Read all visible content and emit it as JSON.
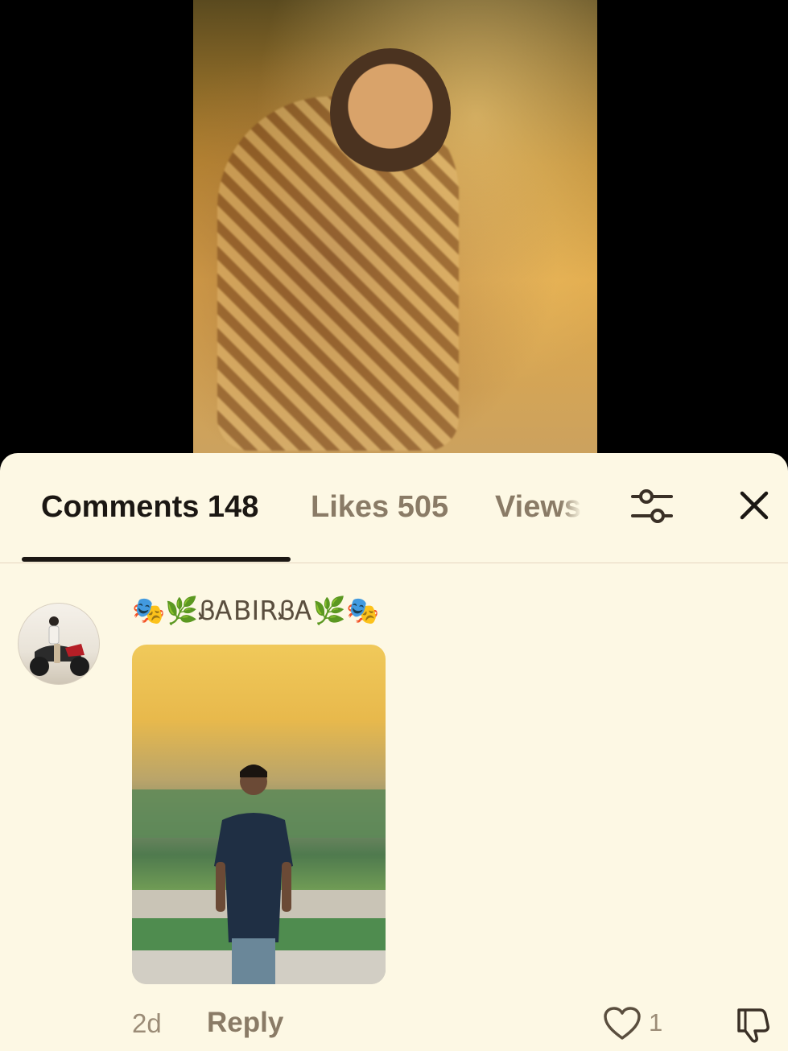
{
  "tabs": {
    "comments_label": "Comments 148",
    "likes_label": "Likes 505",
    "views_label": "Views"
  },
  "comment": {
    "username": "🎭🌿ᏰᎪBIRᏰᎪ🌿🎭",
    "time": "2d",
    "reply_label": "Reply",
    "like_count": "1"
  },
  "icons": {
    "filter": "sliders-icon",
    "close": "close-icon",
    "like": "heart-icon",
    "dislike": "thumbs-down-icon"
  },
  "colors": {
    "sheet_background": "#fdf8e4",
    "active_tab": "#1b1713",
    "inactive_tab": "#8a7b66",
    "muted_text": "#9b8c77"
  }
}
